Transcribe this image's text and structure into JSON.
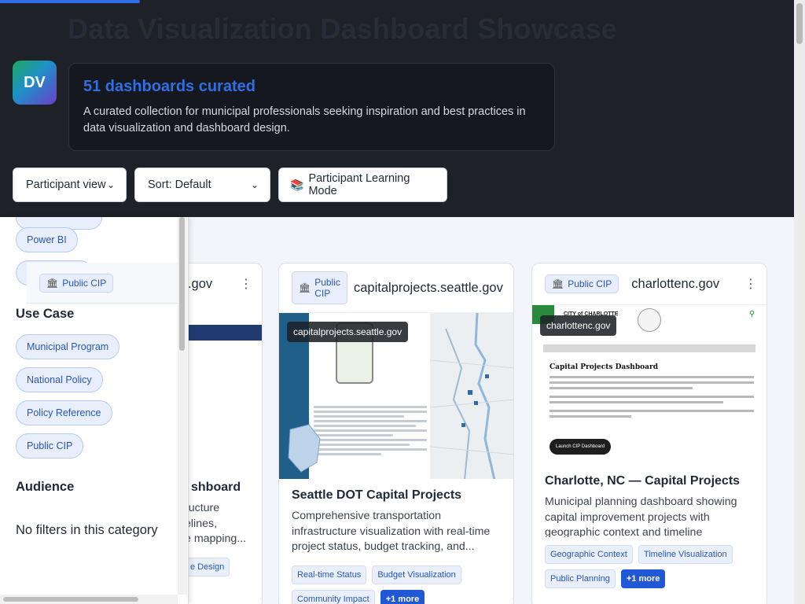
{
  "header": {
    "title": "Data Visualization Dashboard Showcase",
    "logo_text": "DV",
    "count_text": "51 dashboards curated",
    "description": "A curated collection for municipal professionals seeking inspiration and best practices in data visualization and dashboard design."
  },
  "controls": {
    "view": "Participant view",
    "sort": "Sort: Default",
    "learning_mode": "Participant Learning Mode"
  },
  "sidebar": {
    "top_pill": "Power BI",
    "use_case_heading": "Use Case",
    "use_case_items": [
      "Municipal Program",
      "National Policy",
      "Policy Reference",
      "Public CIP"
    ],
    "audience_heading": "Audience",
    "audience_empty": "No filters in this category"
  },
  "cards": [
    {
      "badge": "Public CIP",
      "domain": "nyc.gov",
      "title": "shboard",
      "description": "ructure\nelines,\ne mapping...\nanding",
      "tags": [
        "e Design"
      ]
    },
    {
      "badge": "Public CIP",
      "domain": "capitalprojects.seattle.gov",
      "tooltip": "capitalprojects.seattle.gov",
      "title": "Seattle DOT Capital Projects",
      "description": "Comprehensive transportation infrastructure visualization with real-time project status, budget tracking, and...",
      "tags": [
        "Real-time Status",
        "Budget Visualization",
        "Community Impact"
      ],
      "more": "+1 more"
    },
    {
      "badge": "Public CIP",
      "domain": "charlottenc.gov",
      "tooltip": "charlottenc.gov",
      "title": "Charlotte, NC — Capital Projects",
      "description": "Municipal planning dashboard showing capital improvement projects with geographic context and timeline visualization. Excellent example of how to",
      "tags": [
        "Geographic Context",
        "Timeline Visualization",
        "Public Planning"
      ],
      "more": "+1 more",
      "preview": {
        "site_name": "CITY of CHARLOTTE",
        "page_heading": "Capital Projects Dashboard",
        "button": "Launch CIP Dashboard"
      }
    }
  ],
  "colors": {
    "accent": "#2f6fe6",
    "header_bg": "#1e2127",
    "tag_bg": "#eaf0fb",
    "more_bg": "#2158d6"
  }
}
